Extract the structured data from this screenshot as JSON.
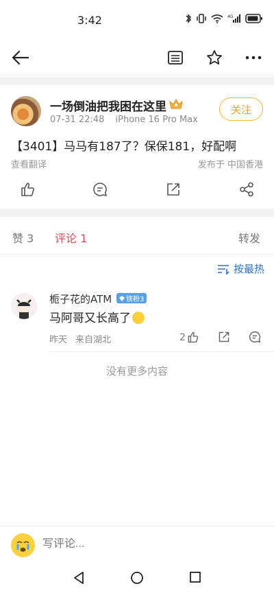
{
  "status_bar": {
    "time": "3:42"
  },
  "nav": {
    "icons": [
      "back-arrow-icon",
      "reader-icon",
      "star-icon",
      "more-icon"
    ]
  },
  "post": {
    "username": "一场倒油把我困在这里",
    "date": "07-31 22:48",
    "device": "iPhone 16 Pro Max",
    "follow_label": "关注",
    "text": "【3401】马马有187了？保保181，好配啊",
    "translate_label": "查看翻译",
    "location": "发布于 中国香港"
  },
  "tabs": {
    "like": "赞 3",
    "comment": "评论 1",
    "repost": "转发"
  },
  "sort_label": "按最热",
  "comment": {
    "name": "栀子花的ATM",
    "badge": "铁粉3",
    "text": "马阿哥又长高了",
    "time": "昨天",
    "origin": "来自湖北",
    "likes": "2"
  },
  "no_more": "没有更多内容",
  "input_placeholder": "写评论...",
  "colors": {
    "accent_red": "#e8475a",
    "follow_gold": "#f0a020",
    "link_blue": "#2f6fc0",
    "badge_blue": "#5aa0e8"
  }
}
